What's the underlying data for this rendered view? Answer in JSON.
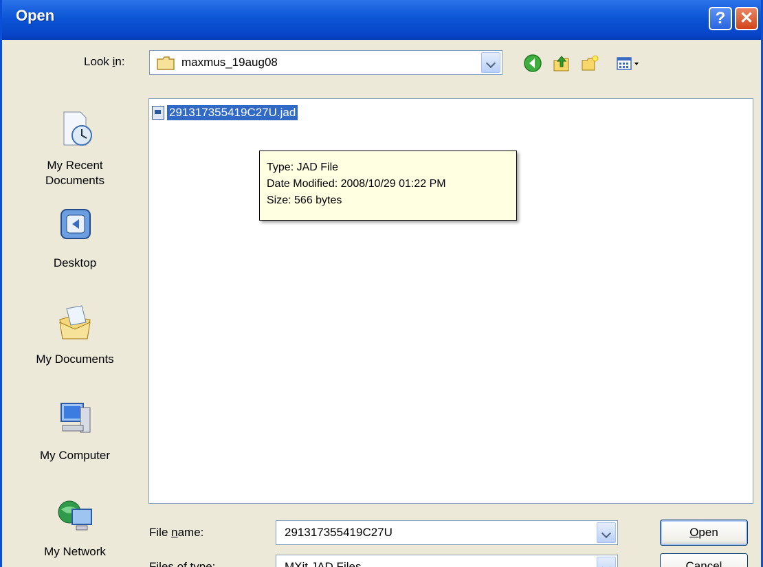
{
  "window": {
    "title": "Open",
    "help_glyph": "?",
    "close_glyph": "✕"
  },
  "lookin": {
    "label_pre": "Look ",
    "label_key": "i",
    "label_post": "n:",
    "folder": "maxmus_19aug08"
  },
  "toolbar": {
    "icons": [
      "back-icon",
      "up-folder-icon",
      "new-folder-icon",
      "views-menu-icon"
    ]
  },
  "places": [
    {
      "id": "recent",
      "line1": "My Recent",
      "line2": "Documents",
      "icon": "recent-documents-icon"
    },
    {
      "id": "desktop",
      "line1": "Desktop",
      "line2": "",
      "icon": "desktop-icon"
    },
    {
      "id": "documents",
      "line1": "My Documents",
      "line2": "",
      "icon": "my-documents-icon"
    },
    {
      "id": "computer",
      "line1": "My Computer",
      "line2": "",
      "icon": "my-computer-icon"
    },
    {
      "id": "network",
      "line1": "My Network",
      "line2": "",
      "icon": "my-network-icon"
    }
  ],
  "files": [
    {
      "name": "291317355419C27U.jad",
      "selected": true
    }
  ],
  "tooltip": {
    "type": "Type: JAD File",
    "modified": "Date Modified: 2008/10/29 01:22 PM",
    "size": "Size: 566 bytes"
  },
  "filename": {
    "label_pre": "File ",
    "label_key": "n",
    "label_post": "ame:",
    "value": "291317355419C27U"
  },
  "filetype": {
    "label_pre": "Files of ",
    "label_key": "t",
    "label_post": "ype:",
    "value": "MXit JAD Files"
  },
  "buttons": {
    "open_key": "O",
    "open_rest": "pen",
    "cancel": "Cancel"
  },
  "colors": {
    "titlebar": "#0a4fd6",
    "selection": "#316ac5",
    "tooltip_bg": "#ffffe1",
    "dialog_bg": "#ece9d8"
  }
}
